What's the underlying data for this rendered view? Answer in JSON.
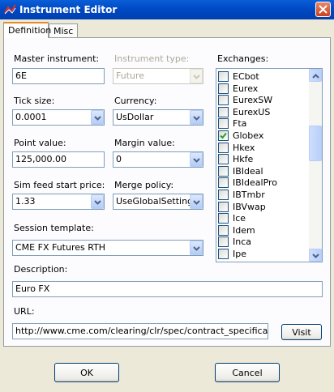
{
  "window": {
    "title": "Instrument Editor"
  },
  "tabs": [
    {
      "label": "Definition"
    },
    {
      "label": "Misc"
    }
  ],
  "form": {
    "master_instrument": {
      "label": "Master instrument:",
      "value": "6E"
    },
    "instrument_type": {
      "label": "Instrument type:",
      "value": "Future"
    },
    "tick_size": {
      "label": "Tick size:",
      "value": "0.0001"
    },
    "currency": {
      "label": "Currency:",
      "value": "UsDollar"
    },
    "point_value": {
      "label": "Point value:",
      "value": "125,000.00"
    },
    "margin_value": {
      "label": "Margin value:",
      "value": "0"
    },
    "sim_feed_start_price": {
      "label": "Sim feed start price:",
      "value": "1.33"
    },
    "merge_policy": {
      "label": "Merge policy:",
      "value": "UseGlobalSettings"
    },
    "session_template": {
      "label": "Session template:",
      "value": "CME FX Futures RTH"
    },
    "description": {
      "label": "Description:",
      "value": "Euro FX"
    },
    "url": {
      "label": "URL:",
      "value": "http://www.cme.com/clearing/clr/spec/contract_specifications_",
      "visit_label": "Visit"
    }
  },
  "exchanges": {
    "label": "Exchanges:",
    "items": [
      {
        "label": "ECbot",
        "checked": false
      },
      {
        "label": "Eurex",
        "checked": false
      },
      {
        "label": "EurexSW",
        "checked": false
      },
      {
        "label": "EurexUS",
        "checked": false
      },
      {
        "label": "Fta",
        "checked": false
      },
      {
        "label": "Globex",
        "checked": true
      },
      {
        "label": "Hkex",
        "checked": false
      },
      {
        "label": "Hkfe",
        "checked": false
      },
      {
        "label": "IBIdeal",
        "checked": false
      },
      {
        "label": "IBIdealPro",
        "checked": false
      },
      {
        "label": "IBTmbr",
        "checked": false
      },
      {
        "label": "IBVwap",
        "checked": false
      },
      {
        "label": "Ice",
        "checked": false
      },
      {
        "label": "Idem",
        "checked": false
      },
      {
        "label": "Inca",
        "checked": false
      },
      {
        "label": "Ipe",
        "checked": false
      }
    ]
  },
  "footer": {
    "ok_label": "OK",
    "cancel_label": "Cancel"
  },
  "colors": {
    "titlebar": "#0049c5",
    "dialog_bg": "#ece9d8",
    "check": "#21a121",
    "accent_tab": "#e68b2c"
  }
}
